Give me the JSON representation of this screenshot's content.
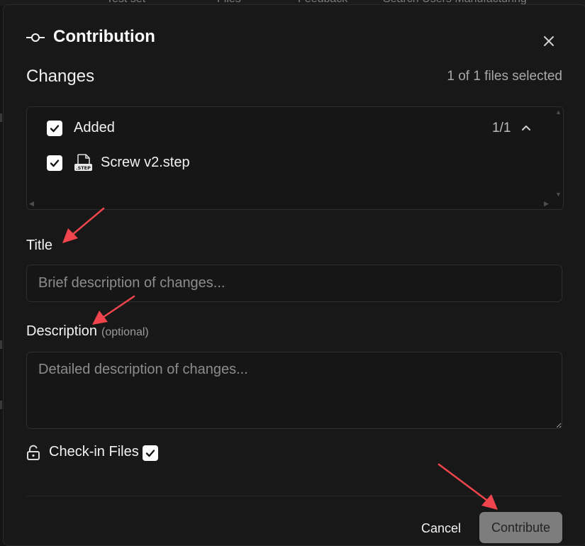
{
  "background": {
    "tabs": [
      "Test set",
      "Files",
      "Feedback",
      "Search Users Manufacturing"
    ]
  },
  "dialog": {
    "title": "Contribution",
    "icon": "commit-icon",
    "close_icon": "close-icon"
  },
  "changes": {
    "title": "Changes",
    "selected_summary": "1 of 1 files selected",
    "group": {
      "label": "Added",
      "count": "1/1",
      "checked": true,
      "expanded": true
    },
    "files": [
      {
        "name": "Screw v2.step",
        "icon": "step-file-icon",
        "checked": true
      }
    ]
  },
  "form": {
    "title_label": "Title",
    "title_placeholder": "Brief description of changes...",
    "title_value": "",
    "description_label": "Description",
    "description_optional": "(optional)",
    "description_placeholder": "Detailed description of changes...",
    "description_value": ""
  },
  "checkin": {
    "label": "Check-in Files",
    "checked": true,
    "icon": "unlock-icon"
  },
  "actions": {
    "cancel_label": "Cancel",
    "contribute_label": "Contribute"
  },
  "colors": {
    "background": "#181818",
    "annotation_arrow": "#f0454d",
    "contribute_button": "#7d7d7d"
  }
}
